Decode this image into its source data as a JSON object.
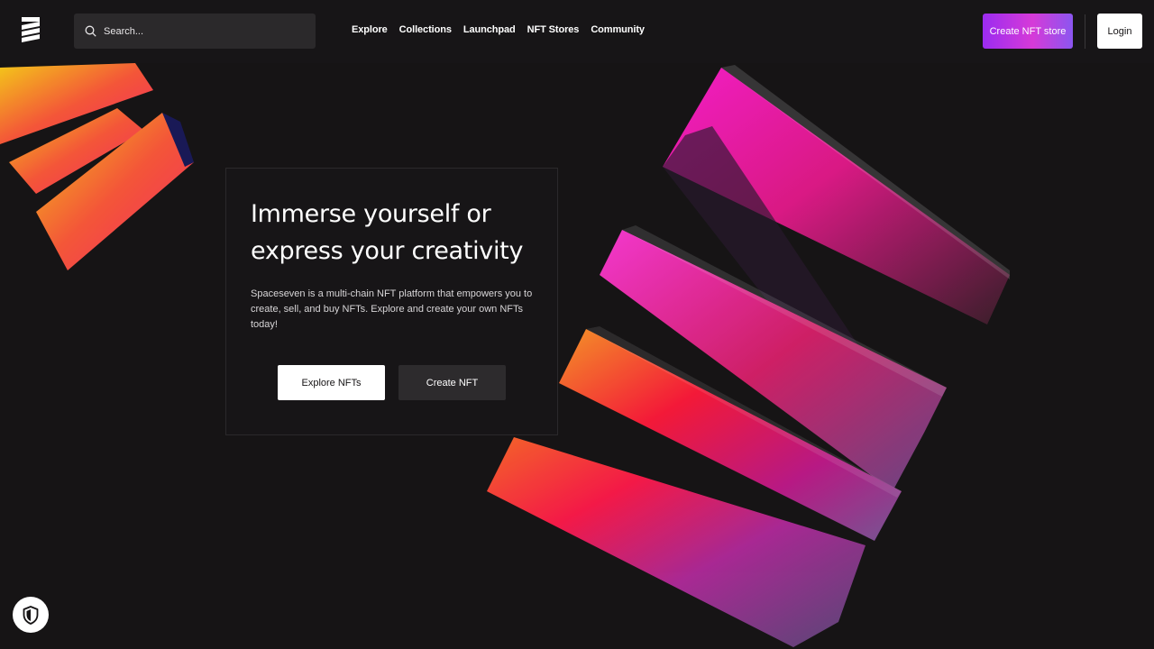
{
  "header": {
    "logo_icon": "spaceseven-logo-icon",
    "search": {
      "placeholder": "Search...",
      "icon": "search-icon"
    },
    "nav": [
      {
        "label": "Explore"
      },
      {
        "label": "Collections"
      },
      {
        "label": "Launchpad"
      },
      {
        "label": "NFT Stores"
      },
      {
        "label": "Community"
      }
    ],
    "create_store_label": "Create NFT store",
    "login_label": "Login"
  },
  "hero": {
    "title_line1": "Immerse yourself or",
    "title_line2": "express your creativity",
    "description": "Spaceseven is a multi-chain NFT platform that empowers you to create, sell, and buy NFTs. Explore and create your own NFTs today!",
    "explore_label": "Explore NFTs",
    "create_label": "Create NFT"
  },
  "privacy_button": {
    "icon": "shield-icon"
  },
  "colors": {
    "background": "#161415",
    "accent_gradient_start": "#9b2cf0",
    "accent_gradient_end": "#d63ad8",
    "magenta": "#ff1fd0",
    "orange": "#ffa41a"
  }
}
